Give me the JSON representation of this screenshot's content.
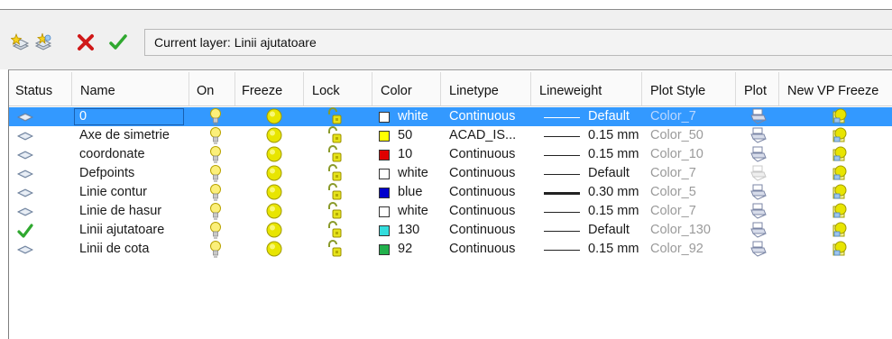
{
  "toolbar": {
    "buttons": [
      {
        "icon": "new-layer-icon"
      },
      {
        "icon": "new-vp-frozen-layer-icon"
      },
      {
        "icon": "delete-layer-icon"
      },
      {
        "icon": "set-current-icon"
      }
    ],
    "current_layer_label": "Current layer: Linii ajutatoare"
  },
  "columns": [
    "Status",
    "Name",
    "On",
    "Freeze",
    "Lock",
    "Color",
    "Linetype",
    "Lineweight",
    "Plot Style",
    "Plot",
    "New VP Freeze"
  ],
  "rows": [
    {
      "status": "layer",
      "name": "0",
      "color_name": "white",
      "color_hex": "#ffffff",
      "linetype": "Continuous",
      "lineweight": "Default",
      "plot_style": "Color_7",
      "plot_enabled": true,
      "selected": true,
      "line_thickness": 1
    },
    {
      "status": "layer",
      "name": "Axe de simetrie",
      "color_name": "50",
      "color_hex": "#ffff00",
      "linetype": "ACAD_IS...",
      "lineweight": "0.15 mm",
      "plot_style": "Color_50",
      "plot_enabled": true,
      "selected": false,
      "line_thickness": 1
    },
    {
      "status": "layer",
      "name": "coordonate",
      "color_name": "10",
      "color_hex": "#e00000",
      "linetype": "Continuous",
      "lineweight": "0.15 mm",
      "plot_style": "Color_10",
      "plot_enabled": true,
      "selected": false,
      "line_thickness": 1
    },
    {
      "status": "layer",
      "name": "Defpoints",
      "color_name": "white",
      "color_hex": "#ffffff",
      "linetype": "Continuous",
      "lineweight": "Default",
      "plot_style": "Color_7",
      "plot_enabled": false,
      "selected": false,
      "line_thickness": 1
    },
    {
      "status": "layer",
      "name": "Linie contur",
      "color_name": "blue",
      "color_hex": "#0000cc",
      "linetype": "Continuous",
      "lineweight": "0.30 mm",
      "plot_style": "Color_5",
      "plot_enabled": true,
      "selected": false,
      "line_thickness": 3
    },
    {
      "status": "layer",
      "name": "Linie de hasur",
      "color_name": "white",
      "color_hex": "#ffffff",
      "linetype": "Continuous",
      "lineweight": "0.15 mm",
      "plot_style": "Color_7",
      "plot_enabled": true,
      "selected": false,
      "line_thickness": 1
    },
    {
      "status": "current",
      "name": "Linii ajutatoare",
      "color_name": "130",
      "color_hex": "#33dddd",
      "linetype": "Continuous",
      "lineweight": "Default",
      "plot_style": "Color_130",
      "plot_enabled": true,
      "selected": false,
      "line_thickness": 1
    },
    {
      "status": "layer",
      "name": "Linii de cota",
      "color_name": "92",
      "color_hex": "#22b14c",
      "linetype": "Continuous",
      "lineweight": "0.15 mm",
      "plot_style": "Color_92",
      "plot_enabled": true,
      "selected": false,
      "line_thickness": 1
    }
  ]
}
